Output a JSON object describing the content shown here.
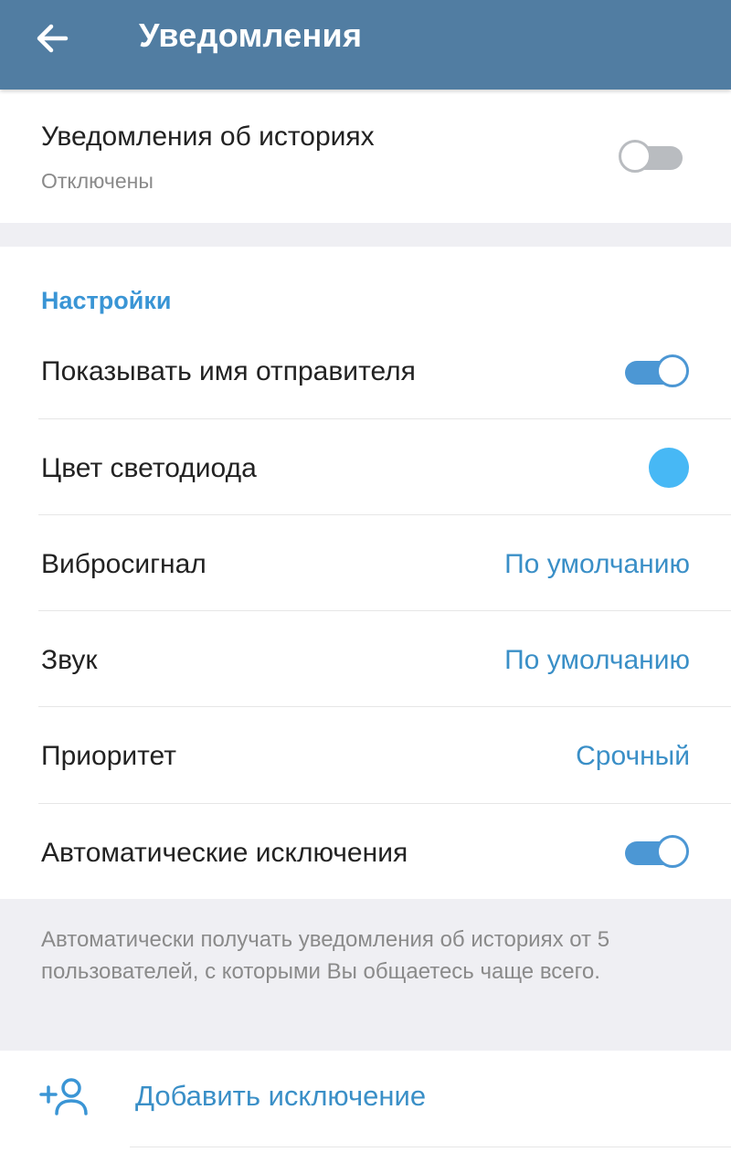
{
  "header": {
    "title": "Уведомления",
    "back_icon": "arrow-back-icon",
    "background_color": "#517da2"
  },
  "stories": {
    "title": "Уведомления об историях",
    "subtitle": "Отключены",
    "enabled": false
  },
  "settings": {
    "section_title": "Настройки",
    "show_sender": {
      "label": "Показывать имя отправителя",
      "enabled": true
    },
    "led_color": {
      "label": "Цвет светодиода",
      "color": "#47b8f5"
    },
    "vibrate": {
      "label": "Вибросигнал",
      "value": "По умолчанию"
    },
    "sound": {
      "label": "Звук",
      "value": "По умолчанию"
    },
    "priority": {
      "label": "Приоритет",
      "value": "Срочный"
    },
    "auto_exceptions": {
      "label": "Автоматические исключения",
      "enabled": true
    }
  },
  "info_note": "Автоматически получать уведомления об историях от 5 пользователей, с которыми Вы общаетесь чаще всего.",
  "add_exception": {
    "label": "Добавить исключение",
    "icon": "add-user-icon"
  },
  "colors": {
    "accent": "#3a8fc7",
    "switch_on": "#4c97d4",
    "switch_off": "#b9bcc0",
    "section_bg": "#efeff3"
  }
}
